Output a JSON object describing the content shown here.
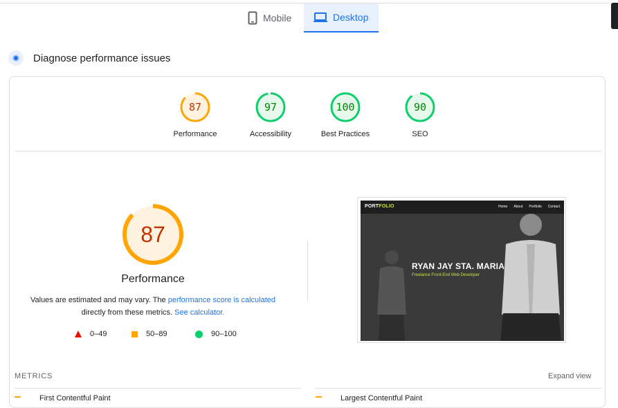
{
  "tabs": {
    "mobile": {
      "label": "Mobile",
      "icon": "phone-icon"
    },
    "desktop": {
      "label": "Desktop",
      "icon": "laptop-icon",
      "active": true
    }
  },
  "diagnose": {
    "title": "Diagnose performance issues",
    "icon": "diagnose-icon"
  },
  "scores": [
    {
      "label": "Performance",
      "value": "87",
      "status": "average"
    },
    {
      "label": "Accessibility",
      "value": "97",
      "status": "pass"
    },
    {
      "label": "Best Practices",
      "value": "100",
      "status": "pass"
    },
    {
      "label": "SEO",
      "value": "90",
      "status": "pass"
    }
  ],
  "main": {
    "score": "87",
    "label": "Performance",
    "desc_prefix": "Values are estimated and may vary. The ",
    "desc_link1": "performance score is calculated",
    "desc_middle": " directly from these metrics. ",
    "desc_link2": "See calculator.",
    "legend": [
      {
        "range": "0–49",
        "shape": "triangle",
        "color": "#eb0f00"
      },
      {
        "range": "50–89",
        "shape": "square",
        "color": "#ffa400"
      },
      {
        "range": "90–100",
        "shape": "circle",
        "color": "#0cce6b"
      }
    ]
  },
  "preview": {
    "logo_a": "PORT",
    "logo_b": "FOLIO",
    "nav": [
      "Home",
      "About",
      "Portfolio",
      "Contact"
    ],
    "name": "RYAN JAY STA. MARIA",
    "subtitle": "Freelance Front-End Web Developer"
  },
  "metrics": {
    "heading": "METRICS",
    "expand": "Expand view",
    "first": "First Contentful Paint",
    "second": "Largest Contentful Paint"
  },
  "colors": {
    "accent": "#1a73e8",
    "average": "#ffa400",
    "pass": "#0cce6b",
    "fail": "#eb0f00"
  }
}
